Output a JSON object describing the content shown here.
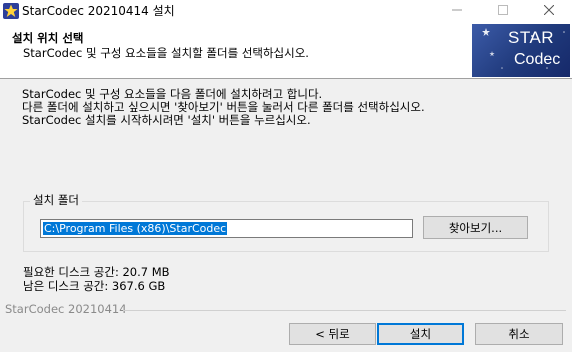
{
  "window": {
    "title": "StarCodec 20210414 설치"
  },
  "header": {
    "title": "설치 위치 선택",
    "subtitle": "StarCodec 및 구성 요소들을 설치할 폴더를 선택하십시오.",
    "logo": {
      "line1": "STAR",
      "line2": "Codec",
      "brand_color": "#203a7c"
    }
  },
  "intro": {
    "lines": [
      "StarCodec 및 구성 요소들을 다음 폴더에 설치하려고 합니다.",
      "다른 폴더에 설치하고 싶으시면 '찾아보기' 버튼을 눌러서 다른 폴더를 선택하십시오.",
      "StarCodec 설치를 시작하시려면 '설치' 버튼을 누르십시오."
    ]
  },
  "install_folder": {
    "label": "설치 폴더",
    "path": "C:\\Program Files (x86)\\StarCodec",
    "browse_label": "찾아보기..."
  },
  "disk": {
    "required": "필요한 디스크 공간: 20.7 MB",
    "available": "남은 디스크 공간: 367.6 GB"
  },
  "footer": {
    "brand": "StarCodec 20210414",
    "back_label": "< 뒤로",
    "install_label": "설치",
    "cancel_label": "취소"
  },
  "icons": {
    "app": "star-app-icon",
    "minimize": "minimize-icon",
    "maximize": "maximize-icon",
    "close": "close-icon"
  }
}
